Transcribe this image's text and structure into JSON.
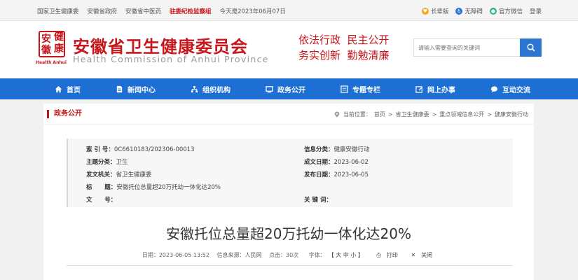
{
  "topbar": {
    "links": [
      "国家卫生健康委",
      "安徽省政府",
      "安徽省中医药",
      "驻委纪检监察组"
    ],
    "date": "今天是2023年06月07日",
    "right": [
      {
        "label": "长辈版",
        "icon": "elder-icon",
        "color": "#f5a623"
      },
      {
        "label": "无障碍",
        "icon": "accessibility-icon",
        "color": "#2b76d2"
      },
      {
        "label": "官方微信",
        "icon": "wechat-icon",
        "color": "#3cb371"
      },
      {
        "label": "登录"
      }
    ]
  },
  "header": {
    "logo_chars": [
      "健",
      "安",
      "徽",
      "康"
    ],
    "logo_sub": "Health Anhui",
    "title_cn": "安徽省卫生健康委员会",
    "title_en": "Health Commission of Anhui Province",
    "slogan_1": "依法行政  民主公开",
    "slogan_2": "务实创新  勤勉清廉",
    "search_placeholder": "请输入需要查询的关键词",
    "accent": "#c8161d"
  },
  "nav": {
    "color": "#1d6fd4",
    "items": [
      {
        "label": "首页",
        "icon": "home-icon"
      },
      {
        "label": "新闻中心",
        "icon": "document-icon"
      },
      {
        "label": "组织机构",
        "icon": "org-chart-icon"
      },
      {
        "label": "政务公开",
        "icon": "monitor-icon"
      },
      {
        "label": "专题专栏",
        "icon": "list-icon"
      },
      {
        "label": "网上办事",
        "icon": "edit-icon"
      },
      {
        "label": "互动交流",
        "icon": "chat-icon"
      }
    ]
  },
  "section": {
    "title": "政务公开",
    "breadcrumb": [
      "当前位置：",
      "首页",
      ">",
      "省卫生健康委",
      ">",
      "重点领域信息公开",
      ">",
      "健康安徽行动"
    ]
  },
  "info": {
    "left": [
      {
        "key": "索 引 号：",
        "value": "0C6610183/202306-00013"
      },
      {
        "key": "主题分类：",
        "value": "卫生"
      },
      {
        "key": "发文机关：",
        "value": "省卫生健康委"
      },
      {
        "key": "标      题：",
        "value": "安徽托位总量超20万托幼一体化达20%"
      },
      {
        "key": "文      号：",
        "value": ""
      }
    ],
    "right": [
      {
        "key": "信息分类：",
        "value": "健康安徽行动"
      },
      {
        "key": "成文日期：",
        "value": "2023-06-02"
      },
      {
        "key": "发布日期：",
        "value": "2023-06-05"
      },
      {
        "key": "",
        "value": ""
      },
      {
        "key": "关 键 词：",
        "value": ""
      }
    ]
  },
  "article": {
    "title": "安徽托位总量超20万托幼一体化达20%",
    "date": "日期：2023-06-05 13:52",
    "source": "信息来源：人民网",
    "hits": "点击：30次",
    "font_label": "字体：",
    "font_sizes": "【 大 中 小 】",
    "print": "打印",
    "close": "关闭"
  }
}
